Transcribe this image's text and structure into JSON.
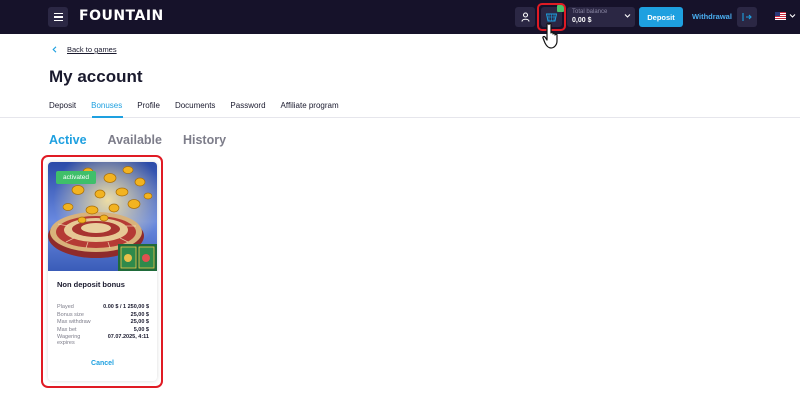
{
  "header": {
    "logo": "FOUNTAIN",
    "balance_label": "Total balance",
    "balance_value": "0,00 $",
    "deposit_label": "Deposit",
    "withdrawal_label": "Withdrawal",
    "cart_highlight_color": "#e01b24",
    "accent": "#1ea0e0"
  },
  "nav": {
    "back_label": "Back to games",
    "title": "My account",
    "tabs": [
      "Deposit",
      "Bonuses",
      "Profile",
      "Documents",
      "Password",
      "Affiliate program"
    ],
    "active_tab": "Bonuses"
  },
  "bonus_tabs": {
    "items": [
      "Active",
      "Available",
      "History"
    ],
    "active": "Active"
  },
  "card": {
    "status": "activated",
    "title": "Non deposit bonus",
    "details": [
      {
        "label": "Played",
        "value": "0.00 $ / 1 250,00 $"
      },
      {
        "label": "Bonus size",
        "value": "25,00 $"
      },
      {
        "label": "Max withdraw",
        "value": "25,00 $"
      },
      {
        "label": "Max bet",
        "value": "5,00 $"
      },
      {
        "label": "Wagering expires",
        "value": "07.07.2025, 4:11"
      }
    ],
    "cancel_label": "Cancel"
  }
}
